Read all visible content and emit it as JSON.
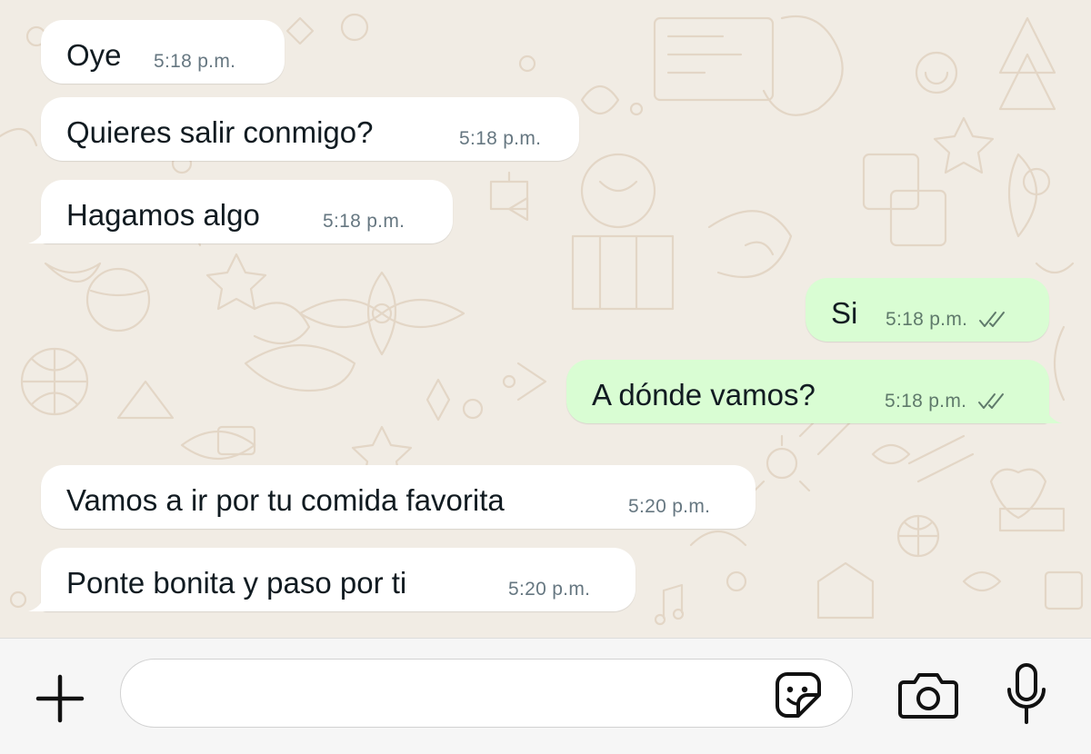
{
  "messages": [
    {
      "direction": "in",
      "text": "Oye",
      "time": "5:18 p.m."
    },
    {
      "direction": "in",
      "text": "Quieres salir conmigo?",
      "time": "5:18 p.m."
    },
    {
      "direction": "in",
      "text": "Hagamos algo",
      "time": "5:18 p.m."
    },
    {
      "direction": "out",
      "text": "Si",
      "time": "5:18 p.m.",
      "status": "read-double-check"
    },
    {
      "direction": "out",
      "text": "A dónde vamos?",
      "time": "5:18 p.m.",
      "status": "read-double-check"
    },
    {
      "direction": "in",
      "text": "Vamos a ir por tu comida favorita",
      "time": "5:20 p.m."
    },
    {
      "direction": "in",
      "text": "Ponte bonita y paso por ti",
      "time": "5:20 p.m."
    }
  ],
  "composer": {
    "input_value": "",
    "icons": [
      "plus-icon",
      "sticker-icon",
      "camera-icon",
      "microphone-icon"
    ]
  },
  "colors": {
    "incoming_bubble": "#ffffff",
    "outgoing_bubble": "#d9fdd3",
    "wallpaper": "#f1ece4",
    "text": "#111b21",
    "timestamp": "#667781"
  }
}
